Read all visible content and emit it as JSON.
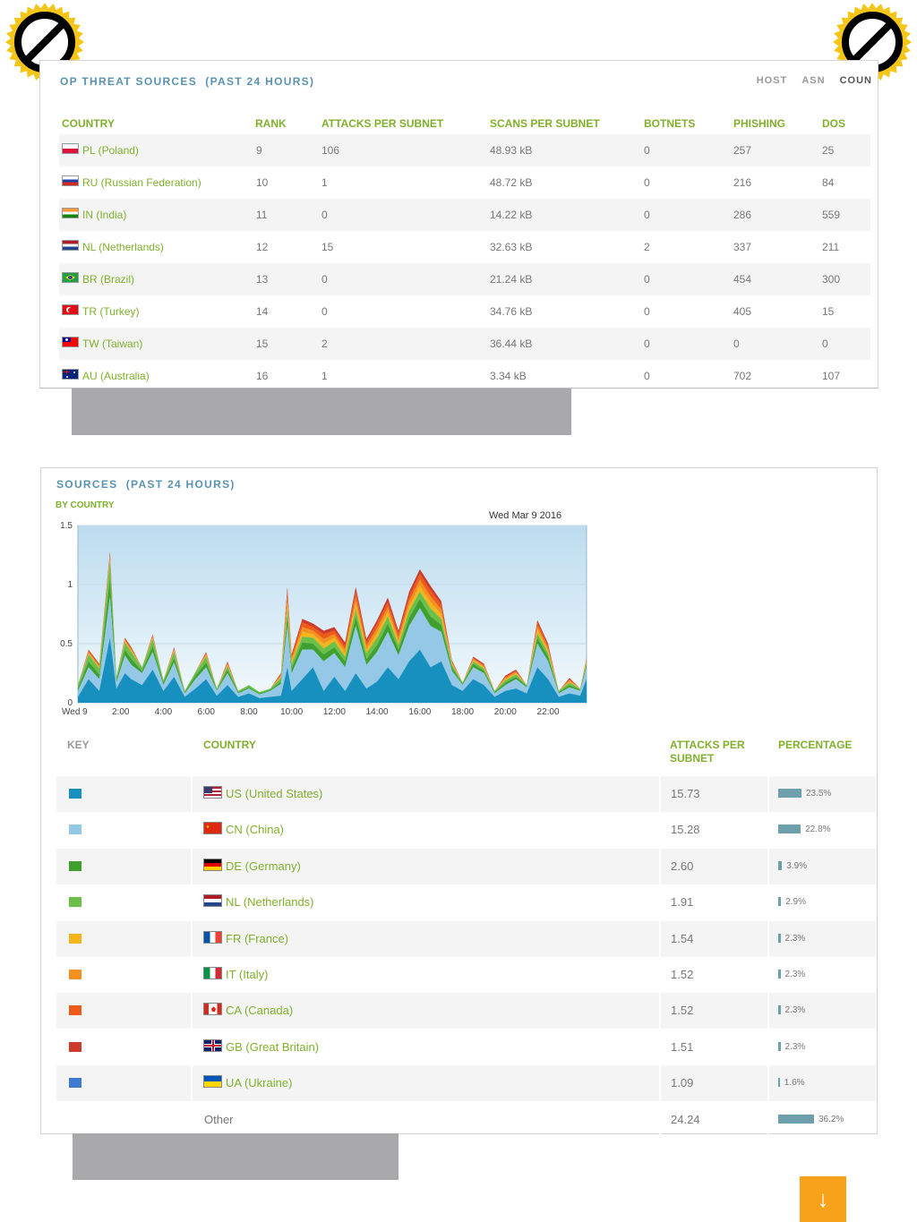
{
  "panel1": {
    "title": "OP THREAT SOURCES",
    "title_suffix": "(PAST 24 HOURS)",
    "tabs": [
      "HOST",
      "ASN",
      "COUN"
    ],
    "columns": [
      "COUNTRY",
      "RANK",
      "ATTACKS PER SUBNET",
      "SCANS PER SUBNET",
      "BOTNETS",
      "PHISHING",
      "DOS"
    ],
    "rows": [
      {
        "country": "PL (Poland)",
        "flag": "pl",
        "rank": "9",
        "attacks": "106",
        "scans": "48.93 kB",
        "botnets": "0",
        "phishing": "257",
        "dos": "25"
      },
      {
        "country": "RU (Russian Federation)",
        "flag": "ru",
        "rank": "10",
        "attacks": "1",
        "scans": "48.72 kB",
        "botnets": "0",
        "phishing": "216",
        "dos": "84"
      },
      {
        "country": "IN (India)",
        "flag": "in",
        "rank": "11",
        "attacks": "0",
        "scans": "14.22 kB",
        "botnets": "0",
        "phishing": "286",
        "dos": "559"
      },
      {
        "country": "NL (Netherlands)",
        "flag": "nl",
        "rank": "12",
        "attacks": "15",
        "scans": "32.63 kB",
        "botnets": "2",
        "phishing": "337",
        "dos": "211"
      },
      {
        "country": "BR (Brazil)",
        "flag": "br",
        "rank": "13",
        "attacks": "0",
        "scans": "21.24 kB",
        "botnets": "0",
        "phishing": "454",
        "dos": "300"
      },
      {
        "country": "TR (Turkey)",
        "flag": "tr",
        "rank": "14",
        "attacks": "0",
        "scans": "34.76 kB",
        "botnets": "0",
        "phishing": "405",
        "dos": "15"
      },
      {
        "country": "TW (Taiwan)",
        "flag": "tw",
        "rank": "15",
        "attacks": "2",
        "scans": "36.44 kB",
        "botnets": "0",
        "phishing": "0",
        "dos": "0"
      },
      {
        "country": "AU (Australia)",
        "flag": "au",
        "rank": "16",
        "attacks": "1",
        "scans": "3.34 kB",
        "botnets": "0",
        "phishing": "702",
        "dos": "107"
      }
    ]
  },
  "panel2": {
    "title": "SOURCES",
    "title_suffix": "(PAST 24 HOURS)",
    "subtitle": "BY COUNTRY",
    "date_label": "Wed Mar 9 2016",
    "columns": [
      "KEY",
      "COUNTRY",
      "ATTACKS PER SUBNET",
      "PERCENTAGE"
    ],
    "rows": [
      {
        "color": "#1790c0",
        "flag": "us",
        "country": "US (United States)",
        "attacks": "15.73",
        "percent": "23.5%",
        "pct": 23.5
      },
      {
        "color": "#94c8e6",
        "flag": "cn",
        "country": "CN (China)",
        "attacks": "15.28",
        "percent": "22.8%",
        "pct": 22.8
      },
      {
        "color": "#3fa030",
        "flag": "de",
        "country": "DE (Germany)",
        "attacks": "2.60",
        "percent": "3.9%",
        "pct": 3.9
      },
      {
        "color": "#6cc04a",
        "flag": "nl",
        "country": "NL (Netherlands)",
        "attacks": "1.91",
        "percent": "2.9%",
        "pct": 2.9
      },
      {
        "color": "#f5b31c",
        "flag": "fr",
        "country": "FR (France)",
        "attacks": "1.54",
        "percent": "2.3%",
        "pct": 2.3
      },
      {
        "color": "#f39020",
        "flag": "it",
        "country": "IT (Italy)",
        "attacks": "1.52",
        "percent": "2.3%",
        "pct": 2.3
      },
      {
        "color": "#ee5a17",
        "flag": "ca",
        "country": "CA (Canada)",
        "attacks": "1.52",
        "percent": "2.3%",
        "pct": 2.3
      },
      {
        "color": "#cc3b2c",
        "flag": "gb",
        "country": "GB (Great Britain)",
        "attacks": "1.51",
        "percent": "2.3%",
        "pct": 2.3
      },
      {
        "color": "#3f7ad0",
        "flag": "ua",
        "country": "UA (Ukraine)",
        "attacks": "1.09",
        "percent": "1.6%",
        "pct": 1.6
      }
    ],
    "other": {
      "label": "Other",
      "attacks": "24.24",
      "percent": "36.2%",
      "pct": 36.2
    }
  },
  "chart_data": {
    "type": "area",
    "stacked": true,
    "xlabel": "",
    "ylabel": "",
    "ylim": [
      0,
      1.5
    ],
    "xlim": [
      0,
      23.8
    ],
    "yticks": [
      "0",
      "0.5",
      "1",
      "1.5"
    ],
    "xticks": [
      {
        "v": 0,
        "label": "Wed 9"
      },
      {
        "v": 2,
        "label": "2:00"
      },
      {
        "v": 4,
        "label": "4:00"
      },
      {
        "v": 6,
        "label": "6:00"
      },
      {
        "v": 8,
        "label": "8:00"
      },
      {
        "v": 10,
        "label": "10:00"
      },
      {
        "v": 12,
        "label": "12:00"
      },
      {
        "v": 14,
        "label": "14:00"
      },
      {
        "v": 16,
        "label": "16:00"
      },
      {
        "v": 18,
        "label": "18:00"
      },
      {
        "v": 20,
        "label": "20:00"
      },
      {
        "v": 22,
        "label": "22:00"
      }
    ],
    "x": [
      0,
      0.5,
      1,
      1.5,
      1.8,
      2.2,
      2.5,
      3,
      3.5,
      4,
      4.5,
      5,
      5.5,
      6,
      6.5,
      7,
      7.5,
      8,
      8.5,
      9,
      9.5,
      9.8,
      10,
      10.5,
      11,
      11.5,
      12,
      12.5,
      13,
      13.5,
      14,
      14.5,
      15,
      15.5,
      16,
      16.5,
      17,
      17.5,
      18,
      18.5,
      19,
      19.5,
      20,
      20.5,
      21,
      21.5,
      22,
      22.5,
      23,
      23.5,
      23.8
    ],
    "series": [
      {
        "color": "#1790c0",
        "values": [
          0.05,
          0.2,
          0.1,
          0.55,
          0.12,
          0.25,
          0.2,
          0.15,
          0.28,
          0.1,
          0.22,
          0.05,
          0.12,
          0.2,
          0.06,
          0.15,
          0.05,
          0.08,
          0.04,
          0.05,
          0.06,
          0.3,
          0.1,
          0.2,
          0.3,
          0.1,
          0.22,
          0.1,
          0.25,
          0.12,
          0.18,
          0.3,
          0.2,
          0.35,
          0.45,
          0.3,
          0.35,
          0.15,
          0.1,
          0.2,
          0.15,
          0.05,
          0.1,
          0.12,
          0.08,
          0.3,
          0.2,
          0.05,
          0.08,
          0.06,
          0.2
        ]
      },
      {
        "color": "#94c8e6",
        "values": [
          0.05,
          0.1,
          0.1,
          0.35,
          0.05,
          0.15,
          0.12,
          0.1,
          0.15,
          0.05,
          0.12,
          0.03,
          0.08,
          0.1,
          0.04,
          0.1,
          0.03,
          0.04,
          0.03,
          0.05,
          0.1,
          0.35,
          0.15,
          0.25,
          0.15,
          0.25,
          0.2,
          0.2,
          0.4,
          0.2,
          0.25,
          0.3,
          0.2,
          0.3,
          0.35,
          0.35,
          0.25,
          0.12,
          0.05,
          0.1,
          0.1,
          0.03,
          0.05,
          0.08,
          0.05,
          0.2,
          0.15,
          0.03,
          0.05,
          0.04,
          0.1
        ]
      },
      {
        "color": "#3fa030",
        "values": [
          0.02,
          0.05,
          0.04,
          0.15,
          0.02,
          0.05,
          0.05,
          0.02,
          0.05,
          0.02,
          0.04,
          0.01,
          0.03,
          0.04,
          0.01,
          0.03,
          0.01,
          0.01,
          0.01,
          0.01,
          0.02,
          0.08,
          0.04,
          0.06,
          0.05,
          0.06,
          0.05,
          0.05,
          0.08,
          0.05,
          0.06,
          0.07,
          0.05,
          0.07,
          0.08,
          0.08,
          0.06,
          0.03,
          0.01,
          0.03,
          0.02,
          0.01,
          0.02,
          0.02,
          0.01,
          0.05,
          0.04,
          0.01,
          0.02,
          0.01,
          0.02
        ]
      },
      {
        "color": "#6cc04a",
        "values": [
          0.03,
          0.06,
          0.05,
          0.15,
          0.03,
          0.06,
          0.06,
          0.03,
          0.06,
          0.02,
          0.05,
          0.01,
          0.03,
          0.05,
          0.01,
          0.03,
          0.01,
          0.02,
          0.01,
          0.01,
          0.03,
          0.06,
          0.04,
          0.05,
          0.05,
          0.05,
          0.05,
          0.04,
          0.06,
          0.05,
          0.06,
          0.06,
          0.04,
          0.06,
          0.06,
          0.07,
          0.05,
          0.02,
          0.01,
          0.02,
          0.02,
          0.01,
          0.02,
          0.02,
          0.01,
          0.04,
          0.03,
          0.01,
          0.02,
          0.01,
          0.02
        ]
      },
      {
        "color": "#f5b31c",
        "values": [
          0,
          0.01,
          0.01,
          0.02,
          0,
          0.01,
          0.01,
          0,
          0.01,
          0,
          0.01,
          0,
          0,
          0.01,
          0,
          0.01,
          0,
          0,
          0,
          0,
          0.01,
          0.05,
          0.02,
          0.04,
          0.03,
          0.04,
          0.03,
          0.03,
          0.05,
          0.03,
          0.04,
          0.04,
          0.03,
          0.04,
          0.05,
          0.05,
          0.04,
          0.01,
          0,
          0.01,
          0.01,
          0,
          0.01,
          0.01,
          0,
          0.03,
          0.02,
          0,
          0.01,
          0,
          0.01
        ]
      },
      {
        "color": "#f39020",
        "values": [
          0,
          0.01,
          0.01,
          0.02,
          0,
          0.01,
          0.01,
          0,
          0.01,
          0,
          0.01,
          0,
          0,
          0.01,
          0,
          0.01,
          0,
          0,
          0,
          0,
          0.01,
          0.05,
          0.02,
          0.04,
          0.03,
          0.04,
          0.03,
          0.03,
          0.05,
          0.03,
          0.04,
          0.04,
          0.03,
          0.04,
          0.05,
          0.05,
          0.04,
          0.01,
          0,
          0.01,
          0.01,
          0,
          0.01,
          0.01,
          0,
          0.03,
          0.02,
          0,
          0.01,
          0,
          0.01
        ]
      },
      {
        "color": "#ee5a17",
        "values": [
          0,
          0.01,
          0.01,
          0.02,
          0,
          0.01,
          0.01,
          0,
          0.01,
          0,
          0.01,
          0,
          0,
          0.01,
          0,
          0.01,
          0,
          0,
          0,
          0,
          0.01,
          0.05,
          0.02,
          0.04,
          0.03,
          0.04,
          0.03,
          0.03,
          0.05,
          0.03,
          0.04,
          0.04,
          0.03,
          0.04,
          0.05,
          0.05,
          0.04,
          0.01,
          0,
          0.01,
          0.01,
          0,
          0.01,
          0.01,
          0,
          0.03,
          0.02,
          0,
          0.01,
          0,
          0.01
        ]
      },
      {
        "color": "#cc3b2c",
        "values": [
          0,
          0.01,
          0.01,
          0.02,
          0,
          0.01,
          0.01,
          0,
          0.01,
          0,
          0.01,
          0,
          0,
          0.01,
          0,
          0.01,
          0,
          0,
          0,
          0,
          0.01,
          0.04,
          0.02,
          0.03,
          0.03,
          0.03,
          0.03,
          0.03,
          0.04,
          0.03,
          0.03,
          0.04,
          0.03,
          0.04,
          0.04,
          0.04,
          0.03,
          0.01,
          0,
          0.01,
          0.01,
          0,
          0.01,
          0.01,
          0,
          0.02,
          0.02,
          0,
          0.01,
          0,
          0.01
        ]
      }
    ]
  },
  "badge_icon": "no-sign-icon",
  "scroll_button_icon": "arrow-down-icon",
  "scroll_button_glyph": "↓"
}
